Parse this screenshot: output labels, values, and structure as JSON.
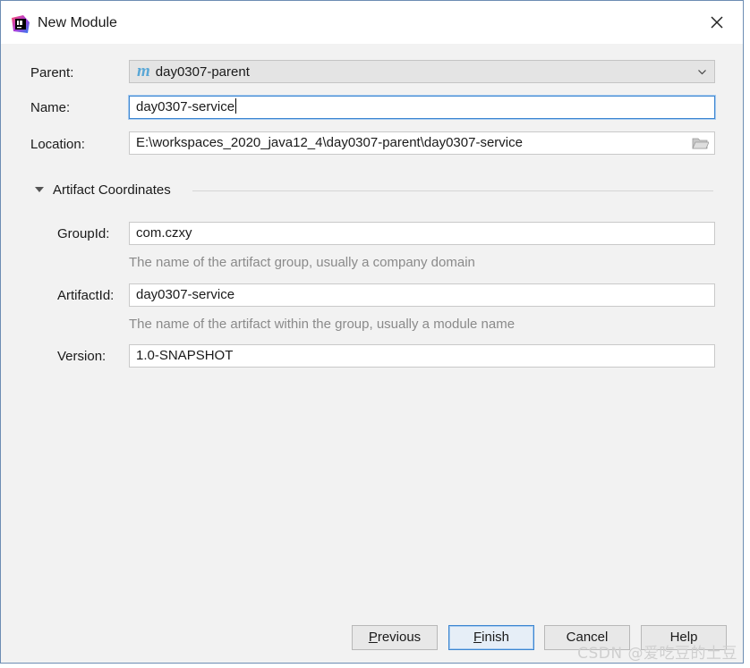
{
  "window": {
    "title": "New Module"
  },
  "form": {
    "parent": {
      "label": "Parent:",
      "value": "day0307-parent",
      "icon": "maven-m-icon"
    },
    "name": {
      "label": "Name:",
      "value": "day0307-service"
    },
    "location": {
      "label": "Location:",
      "value": "E:\\workspaces_2020_java12_4\\day0307-parent\\day0307-service"
    }
  },
  "artifact": {
    "section_title": "Artifact Coordinates",
    "group_id": {
      "label": "GroupId:",
      "value": "com.czxy",
      "hint": "The name of the artifact group, usually a company domain"
    },
    "artifact_id": {
      "label": "ArtifactId:",
      "value": "day0307-service",
      "hint": "The name of the artifact within the group, usually a module name"
    },
    "version": {
      "label": "Version:",
      "value": "1.0-SNAPSHOT"
    }
  },
  "buttons": {
    "previous": {
      "mnemonic": "P",
      "rest": "revious"
    },
    "finish": {
      "mnemonic": "F",
      "rest": "inish"
    },
    "cancel": {
      "label": "Cancel"
    },
    "help": {
      "label": "Help"
    }
  },
  "watermark": "CSDN @爱吃豆的土豆",
  "colors": {
    "accent": "#3d86d1",
    "dialog_bg": "#f2f2f2",
    "hint_text": "#8a8a8a",
    "maven": "#5aa7d6"
  }
}
